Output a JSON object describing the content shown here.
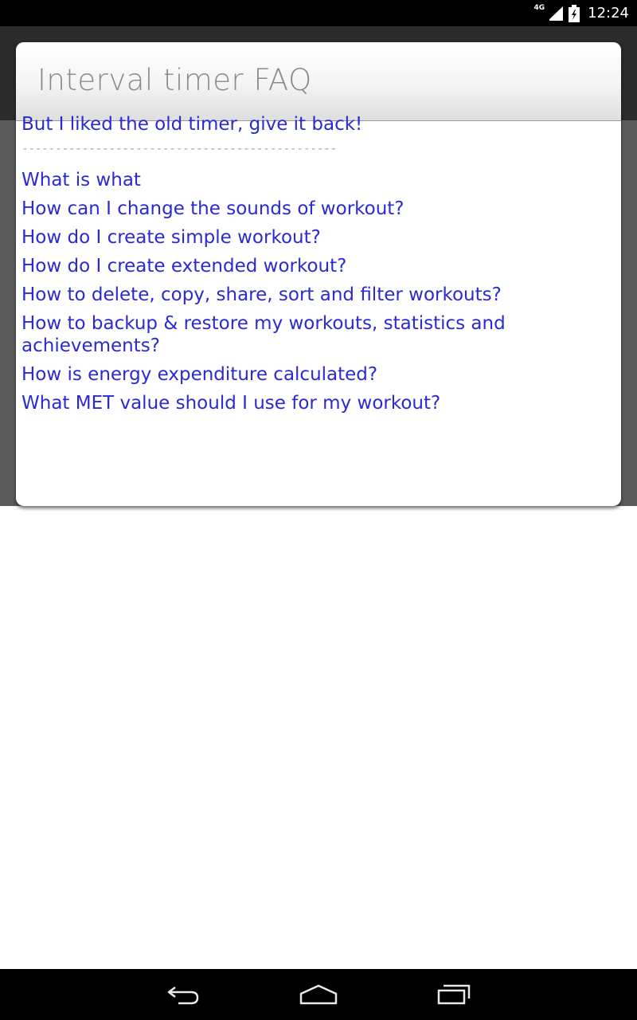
{
  "status_bar": {
    "network": "4G",
    "time": "12:24",
    "icons": [
      "signal-icon",
      "battery-icon"
    ]
  },
  "dialog": {
    "title": "Interval timer FAQ",
    "top_link": "But I liked the old timer, give it back!",
    "divider": "------------------------------------------------------------",
    "links": [
      "What is what",
      "How can I change the sounds of workout?",
      "How do I create simple workout?",
      "How do I create extended workout?",
      "How to delete, copy, share, sort and filter workouts?",
      "How to backup & restore my workouts, statistics and achievements?",
      "How is energy expenditure calculated?",
      "What MET value should I use for my workout?"
    ]
  },
  "nav_bar": {
    "buttons": [
      "back-icon",
      "home-icon",
      "recent-apps-icon"
    ]
  },
  "colors": {
    "link": "#2a2ad4",
    "title": "#8a8a8a",
    "status_bar": "#000000",
    "backdrop": "#5a5a5a"
  }
}
